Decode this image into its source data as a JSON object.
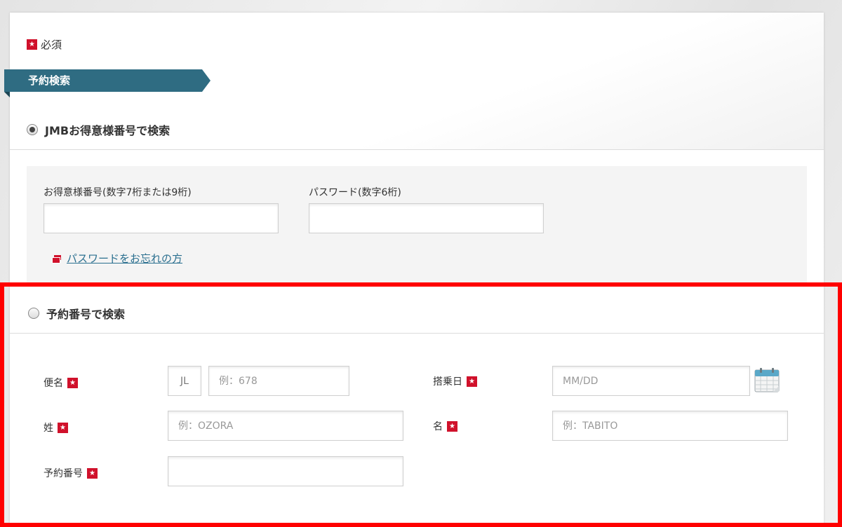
{
  "legend": {
    "badge": "★",
    "label": "必須"
  },
  "section": {
    "title": "予約検索"
  },
  "jmb": {
    "radio_label": "JMBお得意様番号で検索",
    "member_label": "お得意様番号(数字7桁または9桁)",
    "member_value": "",
    "password_label": "パスワード(数字6桁)",
    "password_value": "",
    "forgot_link": "パスワードをお忘れの方"
  },
  "booking": {
    "radio_label": "予約番号で検索",
    "flight_label": "便名",
    "flight_prefix": "JL",
    "flight_placeholder": "例：678",
    "date_label": "搭乗日",
    "date_placeholder": "MM/DD",
    "lastname_label": "姓",
    "lastname_placeholder": "例：OZORA",
    "firstname_label": "名",
    "firstname_placeholder": "例：TABITO",
    "booking_label": "予約番号",
    "booking_value": ""
  },
  "colors": {
    "banner": "#2f6c82",
    "required": "#d0112b",
    "link": "#2a6f8f",
    "highlight_frame": "#ff0000"
  }
}
